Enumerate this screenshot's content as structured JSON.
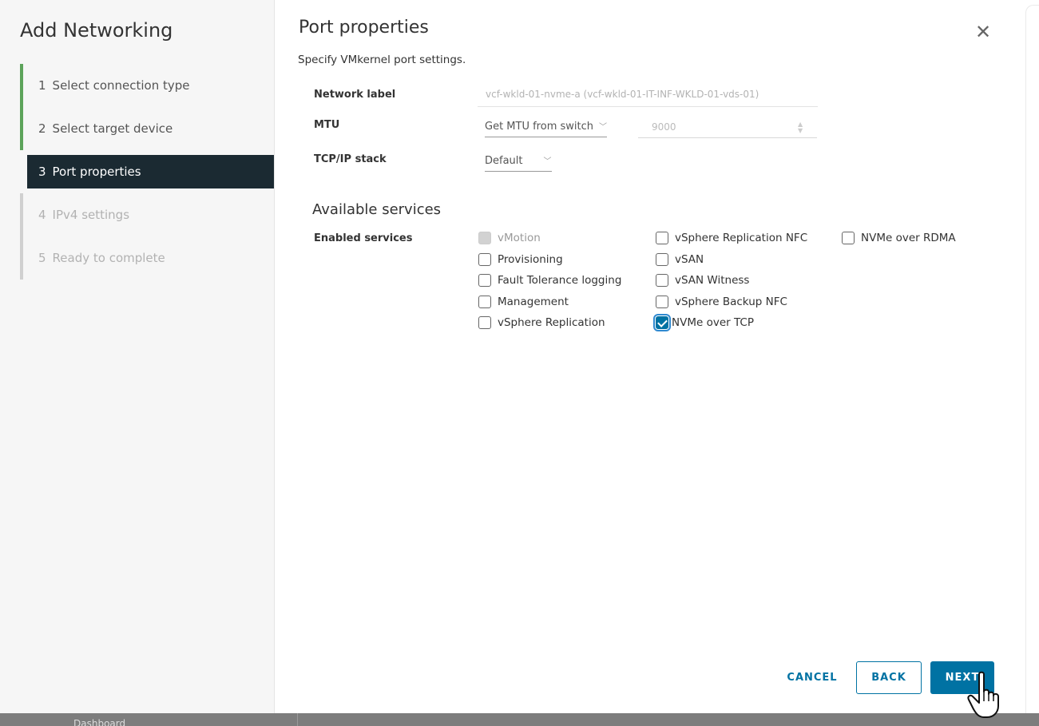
{
  "sidebar": {
    "title": "Add Networking",
    "steps": [
      {
        "num": "1",
        "label": "Select connection type",
        "state": "done"
      },
      {
        "num": "2",
        "label": "Select target device",
        "state": "done"
      },
      {
        "num": "3",
        "label": "Port properties",
        "state": "active"
      },
      {
        "num": "4",
        "label": "IPv4 settings",
        "state": "future"
      },
      {
        "num": "5",
        "label": "Ready to complete",
        "state": "future"
      }
    ]
  },
  "main": {
    "title": "Port properties",
    "subtitle": "Specify VMkernel port settings.",
    "close_icon": "close-icon",
    "fields": {
      "network_label": {
        "label": "Network label",
        "value": "vcf-wkld-01-nvme-a (vcf-wkld-01-IT-INF-WKLD-01-vds-01)"
      },
      "mtu": {
        "label": "MTU",
        "select": "Get MTU from switch",
        "value": "9000"
      },
      "tcpip": {
        "label": "TCP/IP stack",
        "select": "Default"
      }
    },
    "services": {
      "section_title": "Available services",
      "label": "Enabled services",
      "items": [
        {
          "label": "vMotion",
          "checked": false,
          "disabled": true
        },
        {
          "label": "Provisioning",
          "checked": false
        },
        {
          "label": "Fault Tolerance logging",
          "checked": false
        },
        {
          "label": "Management",
          "checked": false
        },
        {
          "label": "vSphere Replication",
          "checked": false
        },
        {
          "label": "vSphere Replication NFC",
          "checked": false
        },
        {
          "label": "vSAN",
          "checked": false
        },
        {
          "label": "vSAN Witness",
          "checked": false
        },
        {
          "label": "vSphere Backup NFC",
          "checked": false
        },
        {
          "label": "NVMe over TCP",
          "checked": true
        },
        {
          "label": "NVMe over RDMA",
          "checked": false
        }
      ]
    },
    "buttons": {
      "cancel": "CANCEL",
      "back": "BACK",
      "next": "NEXT"
    }
  },
  "background": {
    "fragment": "Dashboard"
  },
  "colors": {
    "primary": "#0072a3",
    "active_step_bg": "#1b2a32",
    "done_rail": "#5ca35a"
  }
}
